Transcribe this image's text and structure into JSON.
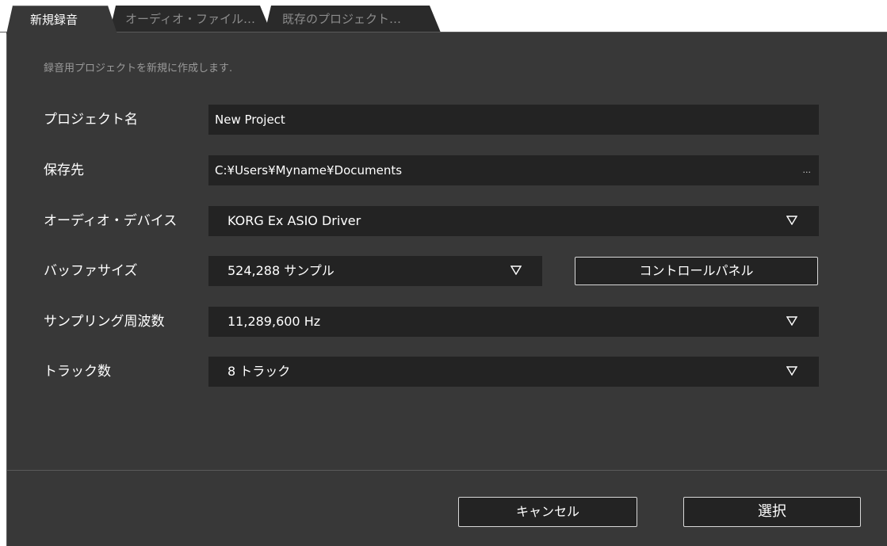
{
  "tabs": [
    {
      "label": "新規録音",
      "active": true
    },
    {
      "label": "オーディオ・ファイル…",
      "active": false
    },
    {
      "label": "既存のプロジェクト…",
      "active": false
    }
  ],
  "description": "録音用プロジェクトを新規に作成します.",
  "fields": {
    "project_name": {
      "label": "プロジェクト名",
      "value": "New Project"
    },
    "save_location": {
      "label": "保存先",
      "value": "C:¥Users¥Myname¥Documents",
      "browse_label": "..."
    },
    "audio_device": {
      "label": "オーディオ・デバイス",
      "value": "KORG Ex ASIO Driver"
    },
    "buffer_size": {
      "label": "バッファサイズ",
      "value": "524,288 サンプル"
    },
    "sample_rate": {
      "label": "サンプリング周波数",
      "value": "11,289,600 Hz"
    },
    "track_count": {
      "label": "トラック数",
      "value": "8 トラック"
    }
  },
  "buttons": {
    "control_panel": "コントロールパネル",
    "cancel": "キャンセル",
    "select": "選択"
  },
  "icons": {
    "dropdown": "triangle-down-outline-icon"
  },
  "colors": {
    "panel_bg": "#383838",
    "field_bg": "#232323",
    "text": "#ffffff",
    "muted_text": "#9a9a9a",
    "inactive_tab_text": "#8c8c8c",
    "button_border": "#d8d8d8"
  }
}
